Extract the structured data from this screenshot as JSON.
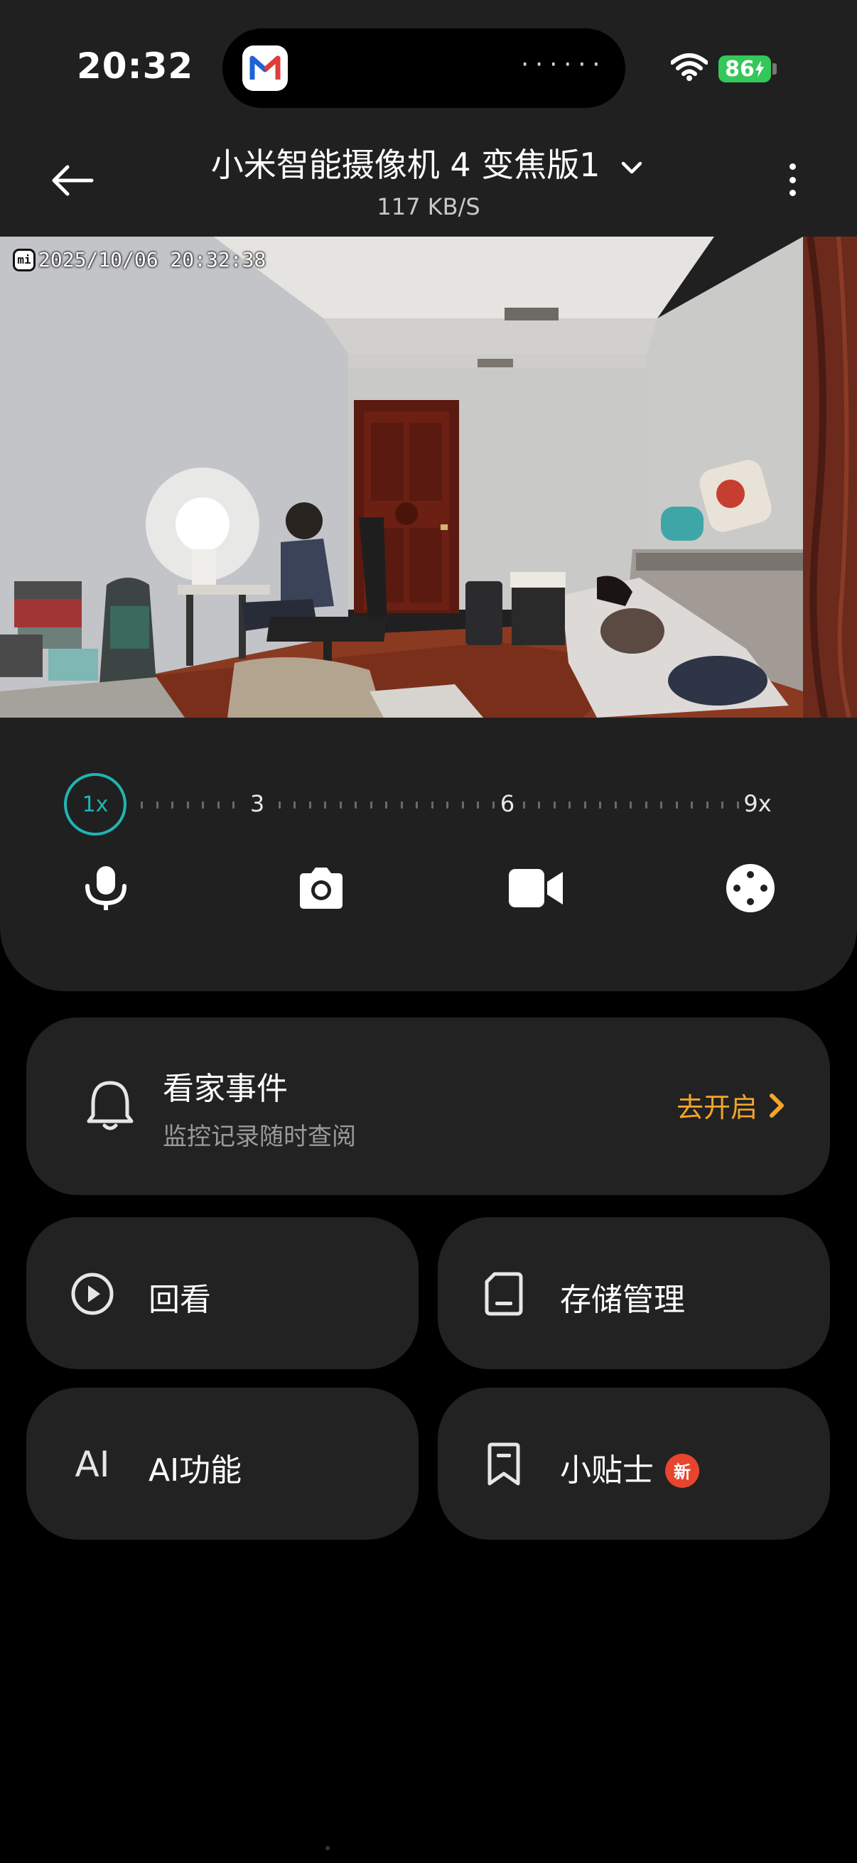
{
  "status_bar": {
    "time": "20:32",
    "battery": "86",
    "island_dots": "······"
  },
  "header": {
    "title": "小米智能摄像机 4 变焦版1",
    "subtitle": "117 KB/S"
  },
  "feed": {
    "timestamp": "2025/10/06 20:32:38",
    "logo": "mi"
  },
  "zoom": {
    "current": "1x",
    "labels": [
      "3",
      "6",
      "9x"
    ]
  },
  "controls": [
    "microphone-icon",
    "camera-icon",
    "video-icon",
    "gamepad-icon"
  ],
  "event_card": {
    "title": "看家事件",
    "subtitle": "监控记录随时查阅",
    "action": "去开启"
  },
  "tiles": [
    {
      "label": "回看",
      "icon": "play-circle-icon"
    },
    {
      "label": "存储管理",
      "icon": "sd-card-icon"
    },
    {
      "label": "AI功能",
      "icon": "ai-icon",
      "icon_text": "AI"
    },
    {
      "label": "小贴士",
      "icon": "bookmark-icon",
      "badge": "新"
    }
  ],
  "colors": {
    "accent_teal": "#1fb5b5",
    "accent_orange": "#f4a52a",
    "badge_red": "#e8452e",
    "battery_green": "#34c759"
  }
}
